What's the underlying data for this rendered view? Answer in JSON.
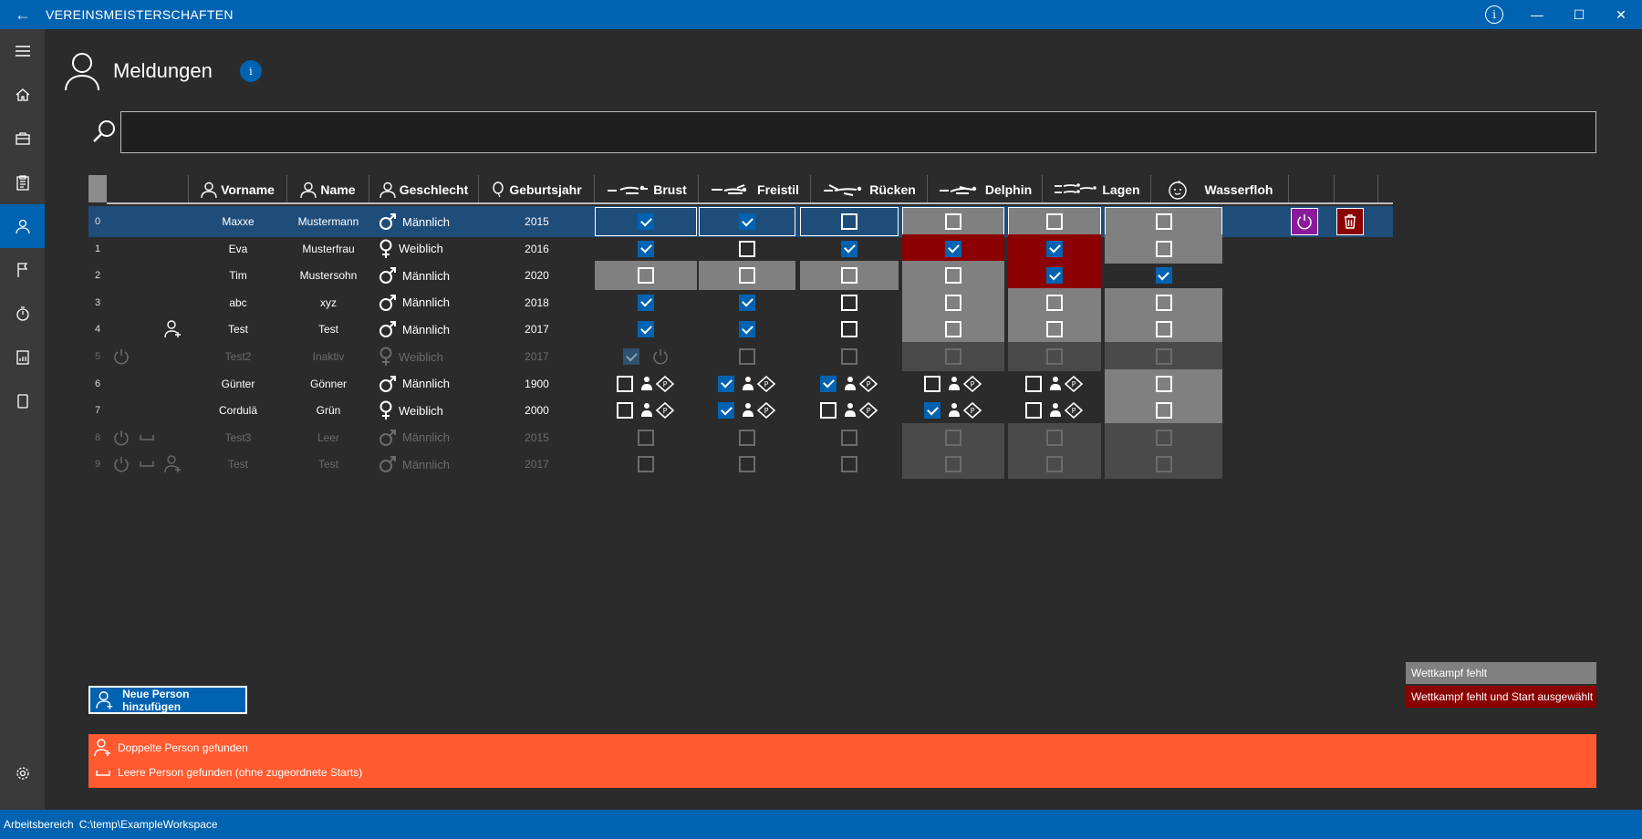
{
  "window": {
    "title": "VEREINSMEISTERSCHAFTEN",
    "info_label": "i"
  },
  "page": {
    "title": "Meldungen",
    "info_label": "i"
  },
  "search": {
    "value": "",
    "placeholder": ""
  },
  "columns": {
    "vorname": "Vorname",
    "name": "Name",
    "geschlecht": "Geschlecht",
    "geburtsjahr": "Geburtsjahr",
    "brust": "Brust",
    "freistil": "Freistil",
    "ruecken": "Rücken",
    "delphin": "Delphin",
    "lagen": "Lagen",
    "wasserfloh": "Wasserfloh"
  },
  "rows": [
    {
      "index": "0",
      "vorname": "Maxxe",
      "name": "Mustermann",
      "geschlecht": "Männlich",
      "jahr": "2015"
    },
    {
      "index": "1",
      "vorname": "Eva",
      "name": "Musterfrau",
      "geschlecht": "Weiblich",
      "jahr": "2016"
    },
    {
      "index": "2",
      "vorname": "Tim",
      "name": "Mustersohn",
      "geschlecht": "Männlich",
      "jahr": "2020"
    },
    {
      "index": "3",
      "vorname": "abc",
      "name": "xyz",
      "geschlecht": "Männlich",
      "jahr": "2018"
    },
    {
      "index": "4",
      "vorname": "Test",
      "name": "Test",
      "geschlecht": "Männlich",
      "jahr": "2017"
    },
    {
      "index": "5",
      "vorname": "Test2",
      "name": "Inaktiv",
      "geschlecht": "Weiblich",
      "jahr": "2017"
    },
    {
      "index": "6",
      "vorname": "Günter",
      "name": "Gönner",
      "geschlecht": "Männlich",
      "jahr": "1900"
    },
    {
      "index": "7",
      "vorname": "Cordulä",
      "name": "Grün",
      "geschlecht": "Weiblich",
      "jahr": "2000"
    },
    {
      "index": "8",
      "vorname": "Test3",
      "name": "Leer",
      "geschlecht": "Männlich",
      "jahr": "2015"
    },
    {
      "index": "9",
      "vorname": "Test",
      "name": "Test",
      "geschlecht": "Männlich",
      "jahr": "2017"
    }
  ],
  "buttons": {
    "add_person": "Neue Person hinzufügen"
  },
  "legend": {
    "missing": "Wettkampf fehlt",
    "missing_selected": "Wettkampf fehlt und Start ausgewählt"
  },
  "warnings": {
    "duplicate": "Doppelte Person gefunden",
    "empty": "Leere Person gefunden (ohne zugeordnete Starts)"
  },
  "statusbar": {
    "label": "Arbeitsbereich",
    "path": "C:\\temp\\ExampleWorkspace"
  },
  "colors": {
    "accent": "#0063b1",
    "missing": "#808080",
    "missing_selected": "#8b0000",
    "warning": "#ff5a30"
  }
}
